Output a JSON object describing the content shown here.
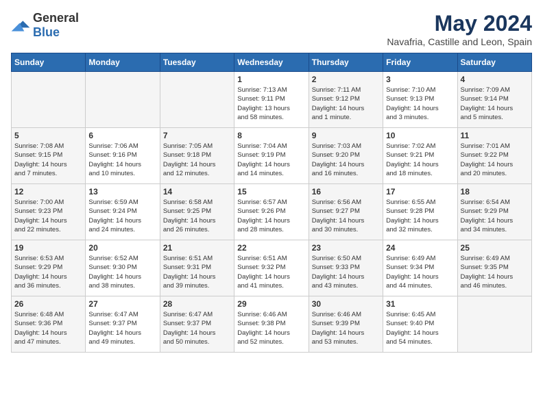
{
  "header": {
    "logo_general": "General",
    "logo_blue": "Blue",
    "month_title": "May 2024",
    "location": "Navafria, Castille and Leon, Spain"
  },
  "weekdays": [
    "Sunday",
    "Monday",
    "Tuesday",
    "Wednesday",
    "Thursday",
    "Friday",
    "Saturday"
  ],
  "weeks": [
    [
      {
        "day": "",
        "info": ""
      },
      {
        "day": "",
        "info": ""
      },
      {
        "day": "",
        "info": ""
      },
      {
        "day": "1",
        "info": "Sunrise: 7:13 AM\nSunset: 9:11 PM\nDaylight: 13 hours\nand 58 minutes."
      },
      {
        "day": "2",
        "info": "Sunrise: 7:11 AM\nSunset: 9:12 PM\nDaylight: 14 hours\nand 1 minute."
      },
      {
        "day": "3",
        "info": "Sunrise: 7:10 AM\nSunset: 9:13 PM\nDaylight: 14 hours\nand 3 minutes."
      },
      {
        "day": "4",
        "info": "Sunrise: 7:09 AM\nSunset: 9:14 PM\nDaylight: 14 hours\nand 5 minutes."
      }
    ],
    [
      {
        "day": "5",
        "info": "Sunrise: 7:08 AM\nSunset: 9:15 PM\nDaylight: 14 hours\nand 7 minutes."
      },
      {
        "day": "6",
        "info": "Sunrise: 7:06 AM\nSunset: 9:16 PM\nDaylight: 14 hours\nand 10 minutes."
      },
      {
        "day": "7",
        "info": "Sunrise: 7:05 AM\nSunset: 9:18 PM\nDaylight: 14 hours\nand 12 minutes."
      },
      {
        "day": "8",
        "info": "Sunrise: 7:04 AM\nSunset: 9:19 PM\nDaylight: 14 hours\nand 14 minutes."
      },
      {
        "day": "9",
        "info": "Sunrise: 7:03 AM\nSunset: 9:20 PM\nDaylight: 14 hours\nand 16 minutes."
      },
      {
        "day": "10",
        "info": "Sunrise: 7:02 AM\nSunset: 9:21 PM\nDaylight: 14 hours\nand 18 minutes."
      },
      {
        "day": "11",
        "info": "Sunrise: 7:01 AM\nSunset: 9:22 PM\nDaylight: 14 hours\nand 20 minutes."
      }
    ],
    [
      {
        "day": "12",
        "info": "Sunrise: 7:00 AM\nSunset: 9:23 PM\nDaylight: 14 hours\nand 22 minutes."
      },
      {
        "day": "13",
        "info": "Sunrise: 6:59 AM\nSunset: 9:24 PM\nDaylight: 14 hours\nand 24 minutes."
      },
      {
        "day": "14",
        "info": "Sunrise: 6:58 AM\nSunset: 9:25 PM\nDaylight: 14 hours\nand 26 minutes."
      },
      {
        "day": "15",
        "info": "Sunrise: 6:57 AM\nSunset: 9:26 PM\nDaylight: 14 hours\nand 28 minutes."
      },
      {
        "day": "16",
        "info": "Sunrise: 6:56 AM\nSunset: 9:27 PM\nDaylight: 14 hours\nand 30 minutes."
      },
      {
        "day": "17",
        "info": "Sunrise: 6:55 AM\nSunset: 9:28 PM\nDaylight: 14 hours\nand 32 minutes."
      },
      {
        "day": "18",
        "info": "Sunrise: 6:54 AM\nSunset: 9:29 PM\nDaylight: 14 hours\nand 34 minutes."
      }
    ],
    [
      {
        "day": "19",
        "info": "Sunrise: 6:53 AM\nSunset: 9:29 PM\nDaylight: 14 hours\nand 36 minutes."
      },
      {
        "day": "20",
        "info": "Sunrise: 6:52 AM\nSunset: 9:30 PM\nDaylight: 14 hours\nand 38 minutes."
      },
      {
        "day": "21",
        "info": "Sunrise: 6:51 AM\nSunset: 9:31 PM\nDaylight: 14 hours\nand 39 minutes."
      },
      {
        "day": "22",
        "info": "Sunrise: 6:51 AM\nSunset: 9:32 PM\nDaylight: 14 hours\nand 41 minutes."
      },
      {
        "day": "23",
        "info": "Sunrise: 6:50 AM\nSunset: 9:33 PM\nDaylight: 14 hours\nand 43 minutes."
      },
      {
        "day": "24",
        "info": "Sunrise: 6:49 AM\nSunset: 9:34 PM\nDaylight: 14 hours\nand 44 minutes."
      },
      {
        "day": "25",
        "info": "Sunrise: 6:49 AM\nSunset: 9:35 PM\nDaylight: 14 hours\nand 46 minutes."
      }
    ],
    [
      {
        "day": "26",
        "info": "Sunrise: 6:48 AM\nSunset: 9:36 PM\nDaylight: 14 hours\nand 47 minutes."
      },
      {
        "day": "27",
        "info": "Sunrise: 6:47 AM\nSunset: 9:37 PM\nDaylight: 14 hours\nand 49 minutes."
      },
      {
        "day": "28",
        "info": "Sunrise: 6:47 AM\nSunset: 9:37 PM\nDaylight: 14 hours\nand 50 minutes."
      },
      {
        "day": "29",
        "info": "Sunrise: 6:46 AM\nSunset: 9:38 PM\nDaylight: 14 hours\nand 52 minutes."
      },
      {
        "day": "30",
        "info": "Sunrise: 6:46 AM\nSunset: 9:39 PM\nDaylight: 14 hours\nand 53 minutes."
      },
      {
        "day": "31",
        "info": "Sunrise: 6:45 AM\nSunset: 9:40 PM\nDaylight: 14 hours\nand 54 minutes."
      },
      {
        "day": "",
        "info": ""
      }
    ]
  ]
}
